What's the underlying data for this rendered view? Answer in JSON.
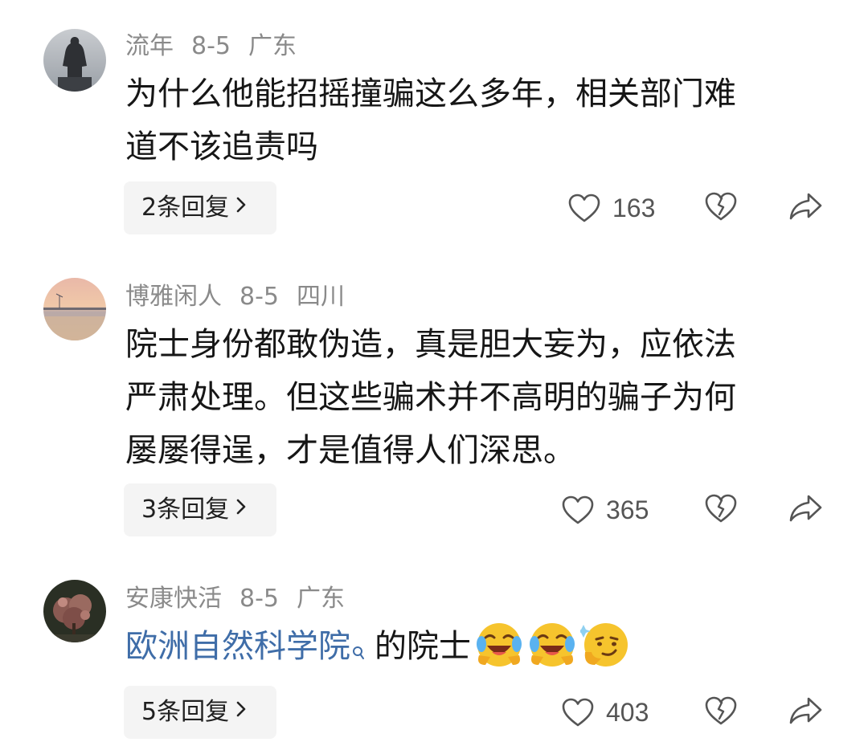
{
  "comments": [
    {
      "user": "流年",
      "date": "8-5",
      "location": "广东",
      "lines": [
        "为什么他能招摇撞骗这么多年，相关部门难",
        "道不该追责吗"
      ],
      "replies_label": "2条回复",
      "likes": "163",
      "avatar_icon": "statue-silhouette-avatar"
    },
    {
      "user": "博雅闲人",
      "date": "8-5",
      "location": "四川",
      "lines": [
        "院士身份都敢伪造，真是胆大妄为，应依法",
        "严肃处理。但这些骗术并不高明的骗子为何",
        "屡屡得逞，才是值得人们深思。"
      ],
      "replies_label": "3条回复",
      "likes": "365",
      "avatar_icon": "sunset-beach-avatar"
    },
    {
      "user": "安康快活",
      "date": "8-5",
      "location": "广东",
      "link_text": "欧洲自然科学院",
      "after_link_text": "的院士",
      "emojis": [
        "laughing-crying-emoji",
        "laughing-crying-emoji",
        "smirk-emoji"
      ],
      "replies_label": "5条回复",
      "likes": "403",
      "avatar_icon": "blossom-tree-avatar"
    }
  ],
  "icons": {
    "chevron": "chevron-right-icon",
    "like": "heart-outline-icon",
    "dislike": "broken-heart-icon",
    "share": "share-arrow-icon",
    "search": "search-mini-icon"
  },
  "colors": {
    "link": "#3f6da8",
    "meta": "#8a8a8a",
    "text": "#161616",
    "button_bg": "#f4f4f4"
  }
}
